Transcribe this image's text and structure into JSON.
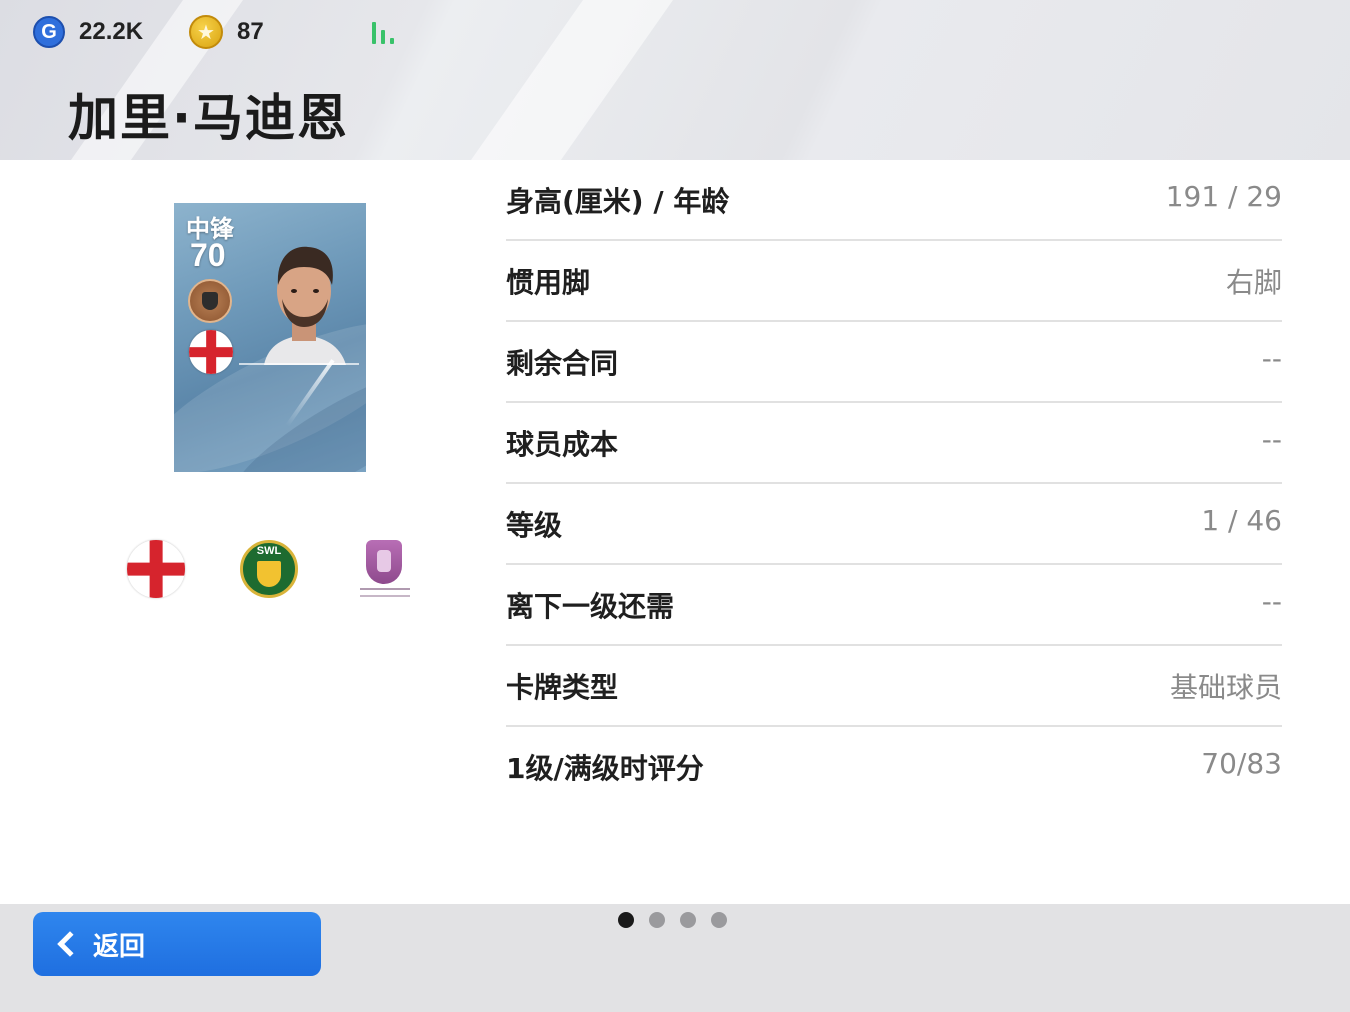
{
  "header": {
    "gp": "22.2K",
    "coins": "87",
    "player_name": "加里·马迪恩"
  },
  "card": {
    "position": "中锋",
    "rating": "70",
    "nationality_flag": "england-flag-icon",
    "club_badge": "swl-club-badge-icon",
    "league_badge": "league-shield-icon"
  },
  "stats": [
    {
      "label": "身高(厘米) / 年龄",
      "value": "191 / 29"
    },
    {
      "label": "惯用脚",
      "value": "右脚"
    },
    {
      "label": "剩余合同",
      "value": "--"
    },
    {
      "label": "球员成本",
      "value": "--"
    },
    {
      "label": "等级",
      "value": "1 / 46"
    },
    {
      "label": "离下一级还需",
      "value": "--"
    },
    {
      "label": "卡牌类型",
      "value": "基础球员"
    },
    {
      "label": "1级/满级时评分",
      "value": "70/83"
    }
  ],
  "footer": {
    "back_label": "返回",
    "page_count": 4,
    "active_page": 1
  },
  "colors": {
    "accent": "#1f6fe0",
    "signal": "#39c26a",
    "flag_red": "#d6242d"
  }
}
